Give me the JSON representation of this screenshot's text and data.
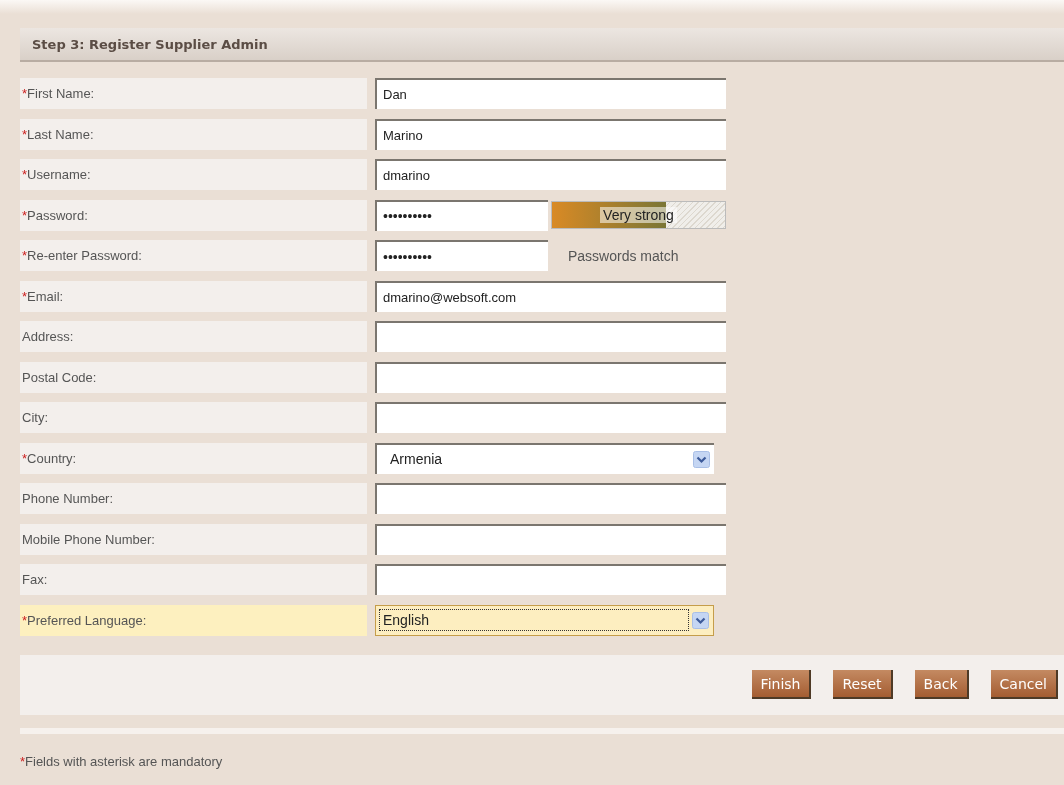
{
  "header": {
    "title": "Step 3: Register Supplier Admin"
  },
  "fields": [
    {
      "kind": "text",
      "required_mark": "*",
      "label": "First Name:",
      "value": "Dan",
      "focused": false
    },
    {
      "kind": "text",
      "required_mark": "*",
      "label": "Last Name:",
      "value": "Marino",
      "focused": false
    },
    {
      "kind": "text",
      "required_mark": "*",
      "label": "Username:",
      "value": "dmarino",
      "focused": false
    },
    {
      "kind": "password",
      "required_mark": "*",
      "label": "Password:",
      "value": "••••••••••",
      "focused": false,
      "strength": {
        "level": 0.66,
        "text": "Very strong"
      }
    },
    {
      "kind": "password",
      "required_mark": "*",
      "label": "Re-enter Password:",
      "value": "••••••••••",
      "focused": false,
      "note": "Passwords match"
    },
    {
      "kind": "text",
      "required_mark": "*",
      "label": "Email:",
      "value": "dmarino@websoft.com",
      "focused": false
    },
    {
      "kind": "text",
      "label": "Address:",
      "focused": false
    },
    {
      "kind": "text",
      "label": "Postal Code:",
      "focused": false
    },
    {
      "kind": "text",
      "label": "City:",
      "focused": false
    },
    {
      "kind": "select",
      "required_mark": "*",
      "label": "Country:",
      "value": "Armenia",
      "focused": false
    },
    {
      "kind": "text",
      "label": "Phone Number:",
      "focused": false
    },
    {
      "kind": "text",
      "label": "Mobile Phone Number:",
      "focused": false
    },
    {
      "kind": "text",
      "label": "Fax:",
      "focused": false
    },
    {
      "kind": "select",
      "required_mark": "*",
      "label": "Preferred Language:",
      "value": "English",
      "focused": true
    }
  ],
  "buttons": [
    "Finish",
    "Reset",
    "Back",
    "Cancel"
  ],
  "footer": {
    "mark": "*",
    "text": "Fields with asterisk are mandatory"
  }
}
